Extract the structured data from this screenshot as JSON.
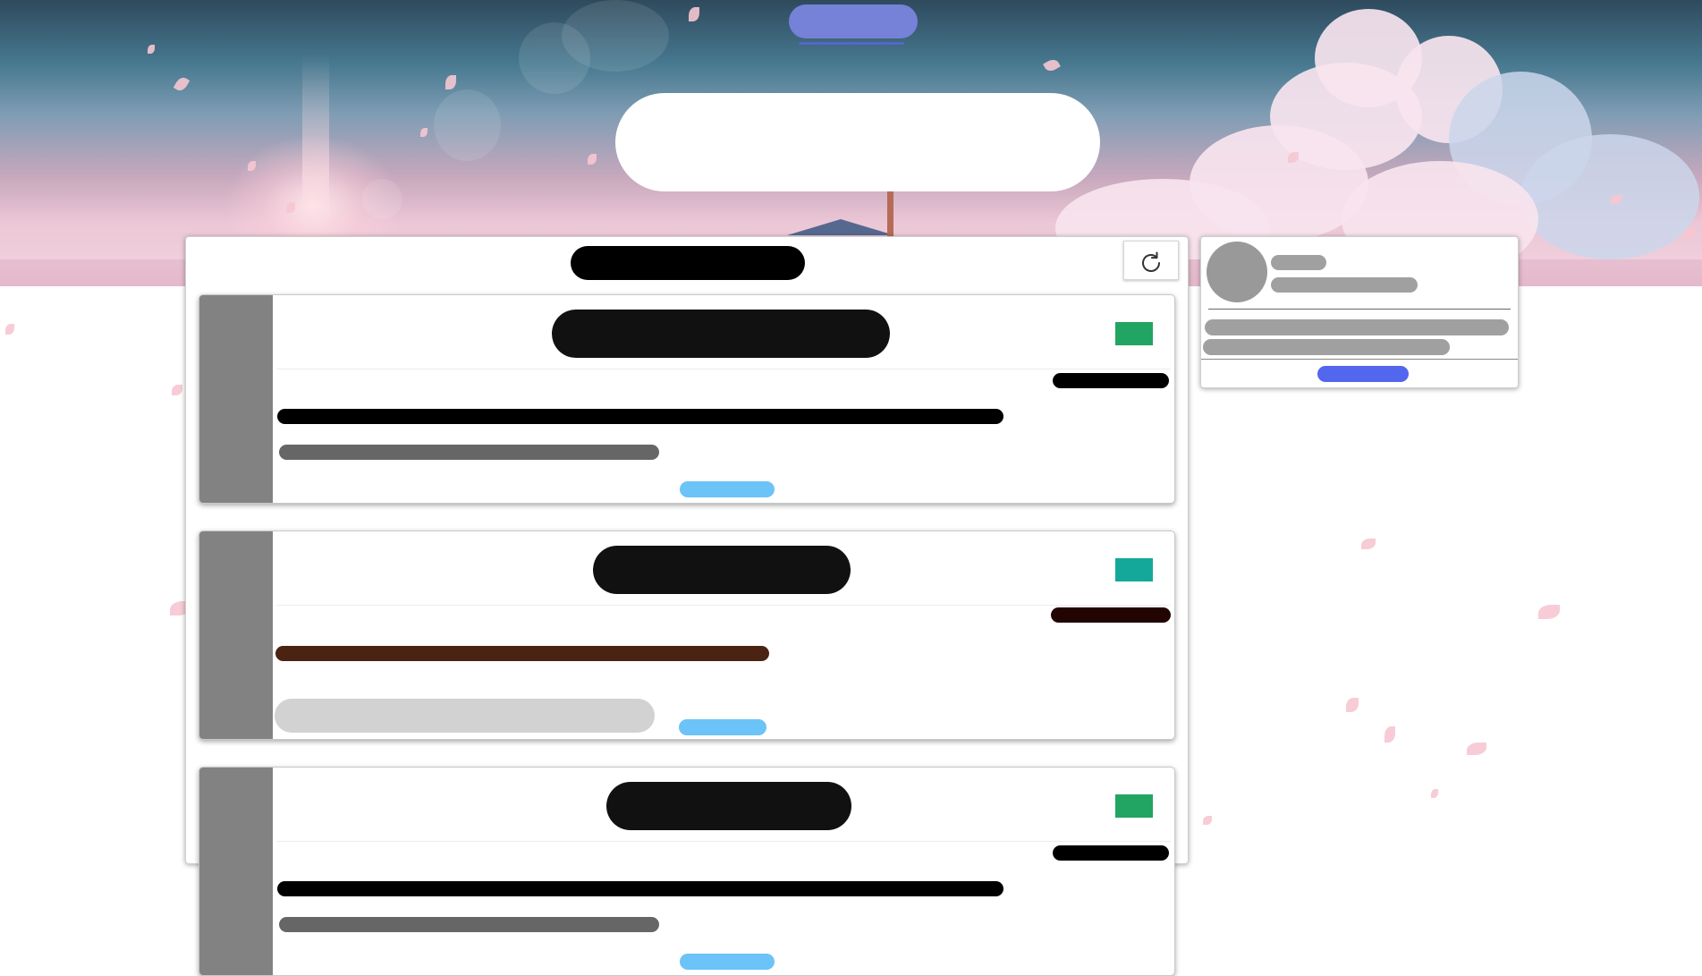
{
  "header": {
    "nav_label": "",
    "site_title": ""
  },
  "feed": {
    "heading": "",
    "refresh_icon": "refresh-icon",
    "posts": [
      {
        "title": "",
        "date": "",
        "excerpt": "",
        "meta": "",
        "read_more": "",
        "tag_color": "#22a463",
        "title_color": "#111111",
        "date_color": "#000000",
        "excerpt_color": "#000000",
        "meta_color": "#666666",
        "meta_style": "bar"
      },
      {
        "title": "",
        "date": "",
        "excerpt": "",
        "meta": "",
        "read_more": "",
        "tag_color": "#14a89a",
        "title_color": "#111111",
        "date_color": "#220503",
        "excerpt_color": "#4a2313",
        "meta_color": "#d2d2d2",
        "meta_style": "block"
      },
      {
        "title": "",
        "date": "",
        "excerpt": "",
        "meta": "",
        "read_more": "",
        "tag_color": "#22a463",
        "title_color": "#111111",
        "date_color": "#000000",
        "excerpt_color": "#000000",
        "meta_color": "#666666",
        "meta_style": "bar"
      }
    ]
  },
  "profile": {
    "name": "",
    "subtitle": "",
    "bio_line_1": "",
    "bio_line_2": "",
    "follow_label": ""
  },
  "colors": {
    "nav_accent": "#7582d8",
    "follow_button": "#5266ee",
    "read_more": "#6cc3f7",
    "petal": "#f6c6d1"
  }
}
